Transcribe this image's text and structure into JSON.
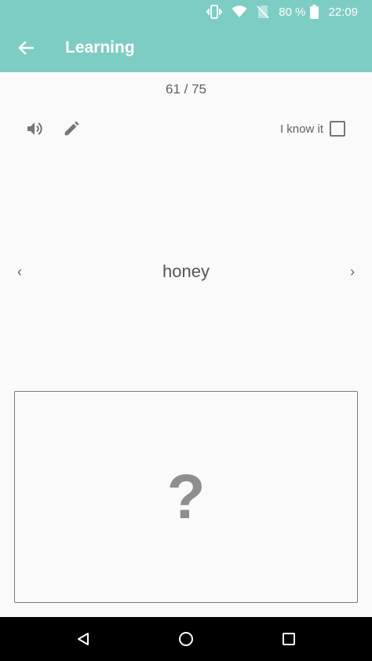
{
  "status_bar": {
    "battery": "80 %",
    "time": "22:09",
    "icons": [
      "vibrate-icon",
      "wifi-icon",
      "no-sim-icon",
      "battery-icon"
    ]
  },
  "app_bar": {
    "title": "Learning",
    "back_icon": "arrow-back-icon"
  },
  "progress": {
    "label": "61 / 75"
  },
  "toolbar": {
    "speaker_icon": "volume-up-icon",
    "edit_icon": "edit-pencil-icon",
    "know_label": "I know it",
    "know_checked": false
  },
  "card": {
    "prev_glyph": "‹",
    "next_glyph": "›",
    "word": "honey",
    "answer_placeholder": "?"
  },
  "nav_bar": {
    "icons": [
      "back-triangle-icon",
      "home-circle-icon",
      "recents-square-icon"
    ]
  },
  "colors": {
    "accent": "#7ecdc4",
    "background": "#fafafa",
    "text": "#616161"
  }
}
